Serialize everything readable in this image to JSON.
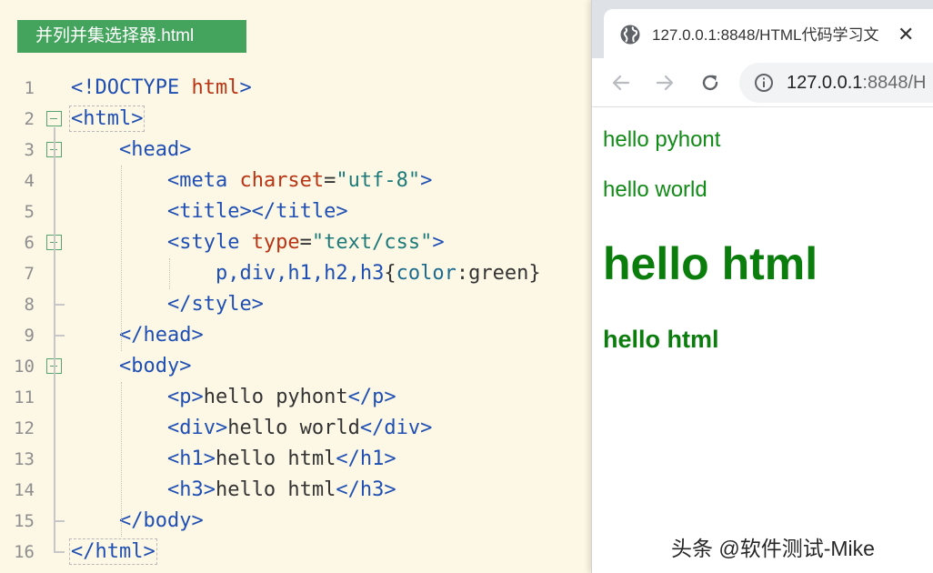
{
  "editor": {
    "file_tab": "并列并集选择器.html",
    "lines": [
      {
        "num": "1",
        "tokens": [
          [
            "t",
            "<!DOCTYPE "
          ],
          [
            "a",
            "html"
          ],
          [
            "t",
            ">"
          ]
        ]
      },
      {
        "num": "2",
        "tokens": [
          [
            "t",
            "<html>"
          ]
        ]
      },
      {
        "num": "3",
        "tokens": [
          [
            "p",
            "    "
          ],
          [
            "t",
            "<head>"
          ]
        ]
      },
      {
        "num": "4",
        "tokens": [
          [
            "p",
            "        "
          ],
          [
            "t",
            "<meta "
          ],
          [
            "a",
            "charset"
          ],
          [
            "p",
            "="
          ],
          [
            "s",
            "\"utf-8\""
          ],
          [
            "t",
            ">"
          ]
        ]
      },
      {
        "num": "5",
        "tokens": [
          [
            "p",
            "        "
          ],
          [
            "t",
            "<title></title>"
          ]
        ]
      },
      {
        "num": "6",
        "tokens": [
          [
            "p",
            "        "
          ],
          [
            "t",
            "<style "
          ],
          [
            "a",
            "type"
          ],
          [
            "p",
            "="
          ],
          [
            "s",
            "\"text/css\""
          ],
          [
            "t",
            ">"
          ]
        ]
      },
      {
        "num": "7",
        "tokens": [
          [
            "p",
            "            "
          ],
          [
            "t",
            "p,div,h1,h2,h3"
          ],
          [
            "p",
            "{"
          ],
          [
            "k",
            "color"
          ],
          [
            "p",
            ":green}"
          ]
        ]
      },
      {
        "num": "8",
        "tokens": [
          [
            "p",
            "        "
          ],
          [
            "t",
            "</style>"
          ]
        ]
      },
      {
        "num": "9",
        "tokens": [
          [
            "p",
            "    "
          ],
          [
            "t",
            "</head>"
          ]
        ]
      },
      {
        "num": "10",
        "tokens": [
          [
            "p",
            "    "
          ],
          [
            "t",
            "<body>"
          ]
        ]
      },
      {
        "num": "11",
        "tokens": [
          [
            "p",
            "        "
          ],
          [
            "t",
            "<p>"
          ],
          [
            "p",
            "hello pyhont"
          ],
          [
            "t",
            "</p>"
          ]
        ]
      },
      {
        "num": "12",
        "tokens": [
          [
            "p",
            "        "
          ],
          [
            "t",
            "<div>"
          ],
          [
            "p",
            "hello world"
          ],
          [
            "t",
            "</div>"
          ]
        ]
      },
      {
        "num": "13",
        "tokens": [
          [
            "p",
            "        "
          ],
          [
            "t",
            "<h1>"
          ],
          [
            "p",
            "hello html"
          ],
          [
            "t",
            "</h1>"
          ]
        ]
      },
      {
        "num": "14",
        "tokens": [
          [
            "p",
            "        "
          ],
          [
            "t",
            "<h3>"
          ],
          [
            "p",
            "hello html"
          ],
          [
            "t",
            "</h3>"
          ]
        ]
      },
      {
        "num": "15",
        "tokens": [
          [
            "p",
            "    "
          ],
          [
            "t",
            "</body>"
          ]
        ]
      },
      {
        "num": "16",
        "tokens": [
          [
            "t",
            "</html>"
          ]
        ]
      }
    ]
  },
  "browser": {
    "tab_title": "127.0.0.1:8848/HTML代码学习文",
    "close_glyph": "✕",
    "url_host": "127.0.0.1",
    "url_rest": ":8848/H",
    "icons": {
      "tab": "globe-icon",
      "back": "arrow-left-icon",
      "forward": "arrow-right-icon",
      "reload": "reload-icon",
      "site_info": "info-icon"
    },
    "page": {
      "p": "hello pyhont",
      "div": "hello world",
      "h1": "hello html",
      "h3": "hello html"
    }
  },
  "watermark": "头条 @软件测试-Mike",
  "colors": {
    "tag": "#1f4fb3",
    "attribute": "#b83412",
    "string": "#1d7a7a",
    "property": "#1c6b8f",
    "rendered_text": "#0a7d0d",
    "file_tab_bg": "#44a35d"
  }
}
